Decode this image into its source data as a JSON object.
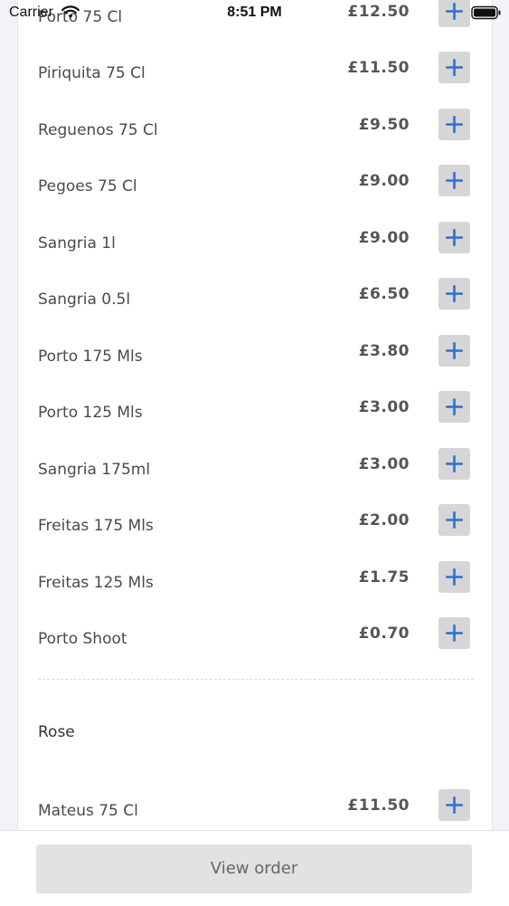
{
  "status_bar": {
    "carrier": "Carrier",
    "time": "8:51 PM"
  },
  "menu": {
    "items": [
      {
        "name": "Porto 75 Cl",
        "price": "£12.50"
      },
      {
        "name": "Piriquita 75 Cl",
        "price": "£11.50"
      },
      {
        "name": "Reguenos 75 Cl",
        "price": "£9.50"
      },
      {
        "name": "Pegoes 75 Cl",
        "price": "£9.00"
      },
      {
        "name": "Sangria 1l",
        "price": "£9.00"
      },
      {
        "name": "Sangria 0.5l",
        "price": "£6.50"
      },
      {
        "name": "Porto 175 Mls",
        "price": "£3.80"
      },
      {
        "name": "Porto 125 Mls",
        "price": "£3.00"
      },
      {
        "name": "Sangria 175ml",
        "price": "£3.00"
      },
      {
        "name": "Freitas 175 Mls",
        "price": "£2.00"
      },
      {
        "name": "Freitas 125 Mls",
        "price": "£1.75"
      },
      {
        "name": "Porto Shoot",
        "price": "£0.70"
      }
    ],
    "rose_section": {
      "heading": "Rose",
      "items": [
        {
          "name": "Mateus 75 Cl",
          "price": "£11.50"
        }
      ]
    }
  },
  "footer": {
    "view_order_label": "View order"
  },
  "colors": {
    "accent": "#2f6fcf",
    "button_bg": "#d6d6d6"
  },
  "icons": {
    "add": "plus-icon",
    "wifi": "wifi-icon",
    "battery": "battery-icon"
  }
}
